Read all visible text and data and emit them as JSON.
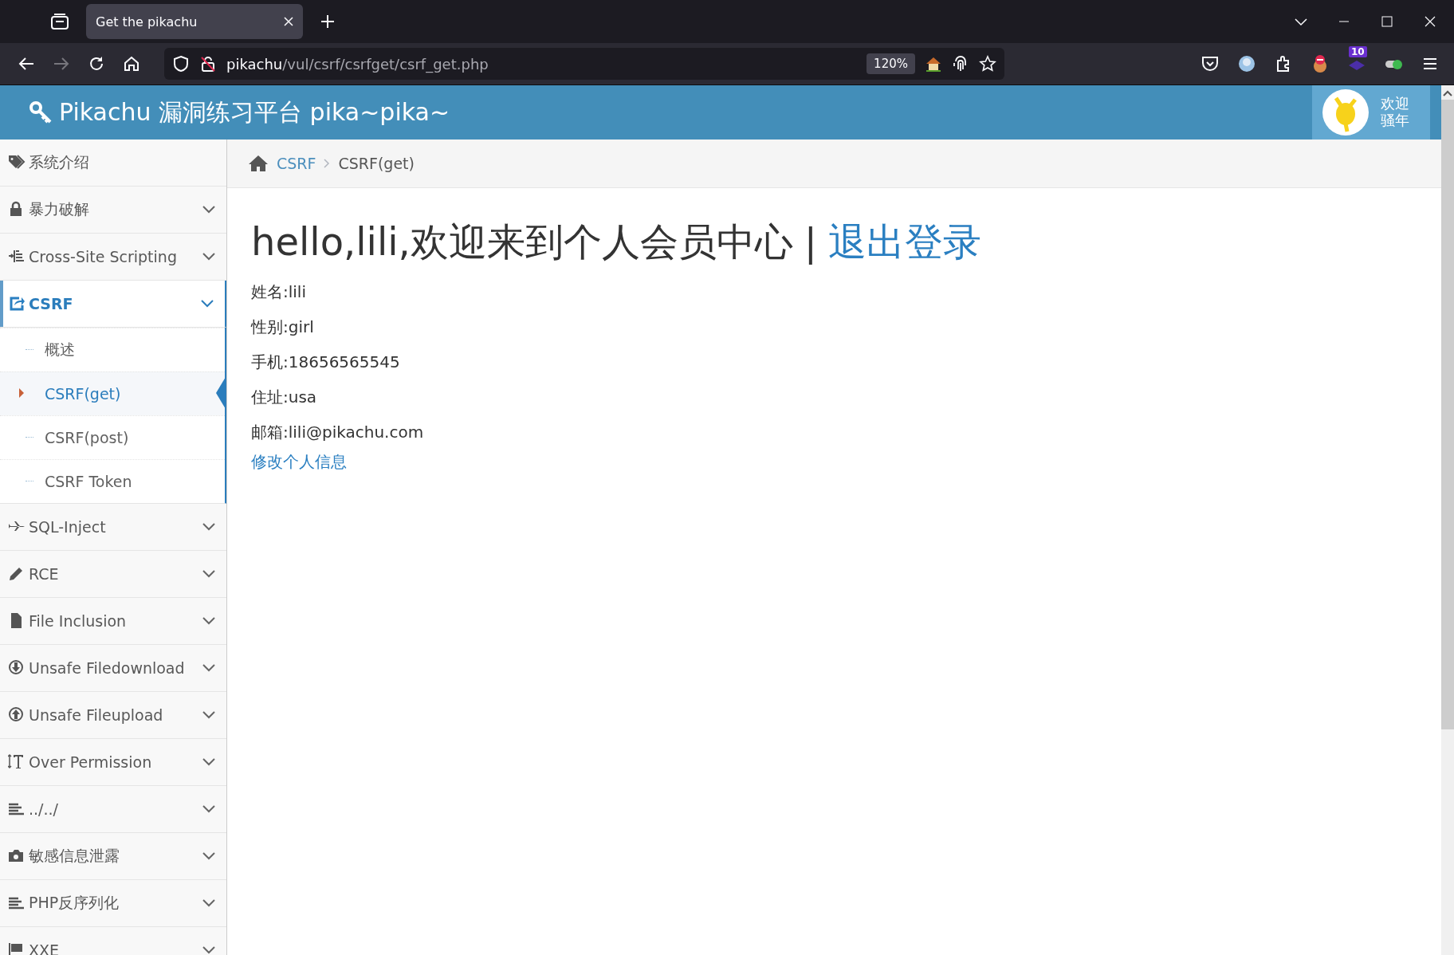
{
  "browser": {
    "tab_title": "Get the pikachu",
    "url_host": "pikachu",
    "url_path": "/vul/csrf/csrfget/csrf_get.php",
    "zoom": "120%",
    "extension_badge": "10"
  },
  "header": {
    "title": "Pikachu 漏洞练习平台 pika~pika~",
    "user_greeting": [
      "欢迎",
      "骚年"
    ]
  },
  "sidebar": {
    "items": [
      {
        "label": "系统介绍",
        "kind": "link",
        "selected": false
      },
      {
        "label": "暴力破解",
        "kind": "menu",
        "selected": false
      },
      {
        "label": "Cross-Site Scripting",
        "kind": "menu",
        "selected": false
      },
      {
        "label": "CSRF",
        "kind": "menu",
        "expanded": true,
        "selected": true,
        "children": [
          {
            "label": "概述",
            "selected": false
          },
          {
            "label": "CSRF(get)",
            "selected": true
          },
          {
            "label": "CSRF(post)",
            "selected": false
          },
          {
            "label": "CSRF Token",
            "selected": false
          }
        ]
      },
      {
        "label": "SQL-Inject",
        "kind": "menu",
        "selected": false
      },
      {
        "label": "RCE",
        "kind": "menu",
        "selected": false
      },
      {
        "label": "File Inclusion",
        "kind": "menu",
        "selected": false
      },
      {
        "label": "Unsafe Filedownload",
        "kind": "menu",
        "selected": false
      },
      {
        "label": "Unsafe Fileupload",
        "kind": "menu",
        "selected": false
      },
      {
        "label": "Over Permission",
        "kind": "menu",
        "selected": false
      },
      {
        "label": "../../",
        "kind": "menu",
        "selected": false
      },
      {
        "label": "敏感信息泄露",
        "kind": "menu",
        "selected": false
      },
      {
        "label": "PHP反序列化",
        "kind": "menu",
        "selected": false
      },
      {
        "label": "XXE",
        "kind": "menu",
        "selected": false
      }
    ]
  },
  "breadcrumb": [
    "CSRF",
    "CSRF(get)"
  ],
  "content": {
    "heading": "hello,lili,欢迎来到个人会员中心",
    "separator": "|",
    "logout_link": "退出登录",
    "fields": [
      "姓名:lili",
      "性别:girl",
      "手机:18656565545",
      "住址:usa",
      "邮箱:lili@pikachu.com"
    ],
    "edit_link": "修改个人信息"
  }
}
